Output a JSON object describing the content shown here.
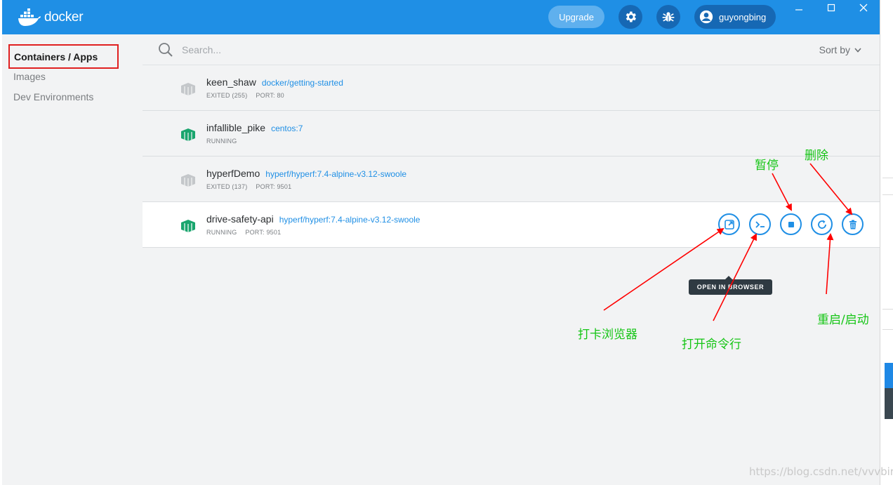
{
  "titlebar": {
    "brand": "docker",
    "upgrade_label": "Upgrade",
    "username": "guyongbing",
    "icons": [
      "whale-logo-icon",
      "gear-icon",
      "bug-icon",
      "user-icon",
      "minimize-icon",
      "maximize-icon",
      "close-icon"
    ],
    "accent_color": "#1f8fe5"
  },
  "sidebar": {
    "items": [
      {
        "label": "Containers / Apps",
        "active": true
      },
      {
        "label": "Images",
        "active": false
      },
      {
        "label": "Dev Environments",
        "active": false
      }
    ]
  },
  "search": {
    "placeholder": "Search...",
    "sort_label": "Sort by"
  },
  "containers": [
    {
      "name": "keen_shaw",
      "image": "docker/getting-started",
      "status": "EXITED (255)",
      "port": "PORT: 80",
      "running": false
    },
    {
      "name": "infallible_pike",
      "image": "centos:7",
      "status": "RUNNING",
      "port": "",
      "running": true
    },
    {
      "name": "hyperfDemo",
      "image": "hyperf/hyperf:7.4-alpine-v3.12-swoole",
      "status": "EXITED (137)",
      "port": "PORT: 9501",
      "running": false
    },
    {
      "name": "drive-safety-api",
      "image": "hyperf/hyperf:7.4-alpine-v3.12-swoole",
      "status": "RUNNING",
      "port": "PORT: 9501",
      "running": true
    }
  ],
  "row_actions": [
    "open-in-browser-icon",
    "cli-icon",
    "stop-icon",
    "restart-icon",
    "delete-icon"
  ],
  "tooltip": "OPEN IN BROWSER",
  "annotations": {
    "pause": "暂停",
    "delete": "删除",
    "open_browser": "打卡浏览器",
    "open_cli": "打开命令行",
    "restart_start": "重启/启动"
  },
  "watermark": "https://blog.csdn.net/vvvbird",
  "colors": {
    "running": "#1aa56e",
    "exited": "#c4c7ca",
    "annotation_text": "#15c515",
    "annotation_arrow": "#ff0000"
  }
}
